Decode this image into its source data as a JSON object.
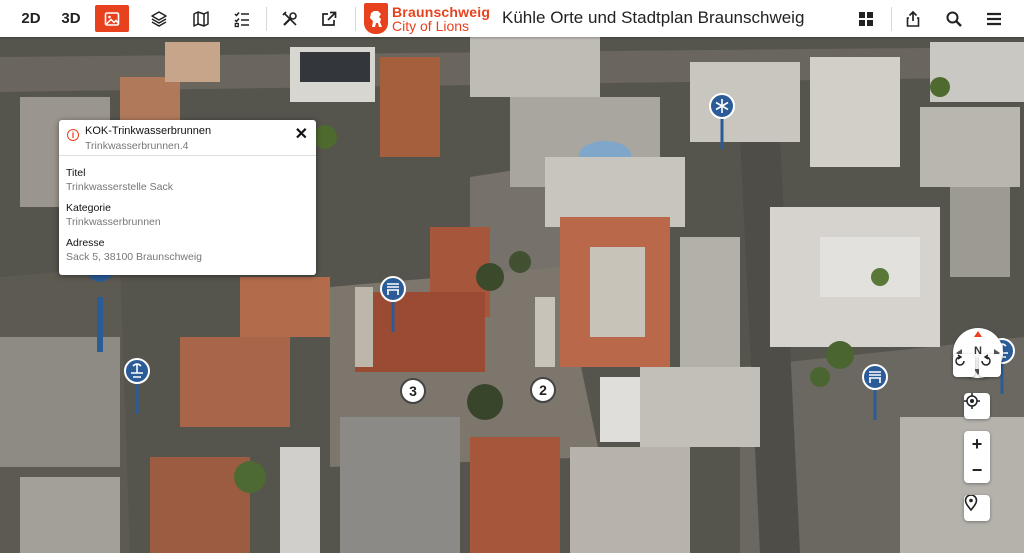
{
  "toolbar": {
    "view_2d": "2D",
    "view_3d": "3D",
    "logo_line1": "Braunschweig",
    "logo_line2": "City of Lions",
    "title": "Kühle Orte und Stadtplan Braunschweig",
    "accent_color": "#e8411e",
    "icons_left": [
      "image-icon",
      "layers-icon",
      "map-icon",
      "list-check-icon",
      "tools-icon",
      "external-link-icon"
    ],
    "icons_right": [
      "grid-icon",
      "share-icon",
      "search-icon",
      "menu-icon"
    ]
  },
  "popup": {
    "title": "KOK-Trinkwasserbrunnen",
    "subtitle": "Trinkwasserbrunnen.4",
    "fields": [
      {
        "label": "Titel",
        "value": "Trinkwasserstelle Sack"
      },
      {
        "label": "Kategorie",
        "value": "Trinkwasserbrunnen"
      },
      {
        "label": "Adresse",
        "value": "Sack 5, 38100 Braunschweig"
      }
    ]
  },
  "markers": {
    "clusters": [
      "3",
      "2"
    ],
    "pin_color": "#2b5c98",
    "pin_icons": [
      "snowflake-icon",
      "bench-icon",
      "fountain-icon",
      "bench-icon",
      "fountain-icon"
    ]
  },
  "controls": {
    "compass_label": "N",
    "zoom_in": "+",
    "zoom_out": "−"
  }
}
